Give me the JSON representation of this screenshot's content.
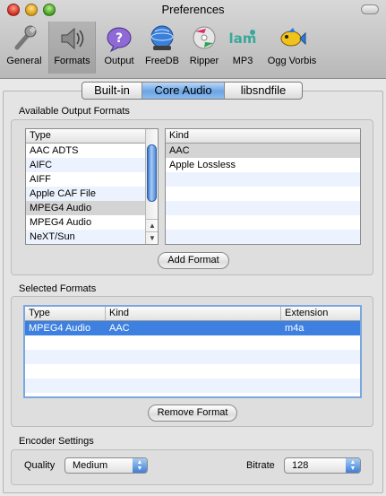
{
  "window": {
    "title": "Preferences"
  },
  "toolbar": {
    "items": [
      {
        "label": "General",
        "icon": "wrench-icon"
      },
      {
        "label": "Formats",
        "icon": "speaker-icon",
        "selected": true
      },
      {
        "label": "Output",
        "icon": "question-speech-icon"
      },
      {
        "label": "FreeDB",
        "icon": "globe-icon"
      },
      {
        "label": "Ripper",
        "icon": "cd-ripper-icon"
      },
      {
        "label": "MP3",
        "icon": "lame-logo-icon"
      },
      {
        "label": "Ogg Vorbis",
        "icon": "fish-icon"
      }
    ]
  },
  "tabs": [
    {
      "label": "Built-in"
    },
    {
      "label": "Core Audio",
      "active": true
    },
    {
      "label": "libsndfile"
    }
  ],
  "available": {
    "title": "Available Output Formats",
    "type_header": "Type",
    "types": [
      "AAC ADTS",
      "AIFC",
      "AIFF",
      "Apple CAF File",
      "MPEG4 Audio",
      "MPEG4 Audio",
      "NeXT/Sun"
    ],
    "selected_type_index": 4,
    "kind_header": "Kind",
    "kinds": [
      "AAC",
      "Apple Lossless"
    ],
    "selected_kind_index": 0,
    "add_button": "Add Format"
  },
  "selected": {
    "title": "Selected Formats",
    "headers": {
      "type": "Type",
      "kind": "Kind",
      "extension": "Extension"
    },
    "rows": [
      {
        "type": "MPEG4 Audio",
        "kind": "AAC",
        "extension": "m4a"
      }
    ],
    "remove_button": "Remove Format"
  },
  "encoder": {
    "title": "Encoder Settings",
    "quality_label": "Quality",
    "quality_value": "Medium",
    "bitrate_label": "Bitrate",
    "bitrate_value": "128"
  },
  "colors": {
    "selection": "#3d80df",
    "tab_active": "#6aa4e4",
    "stripe": "#edf3fe"
  }
}
